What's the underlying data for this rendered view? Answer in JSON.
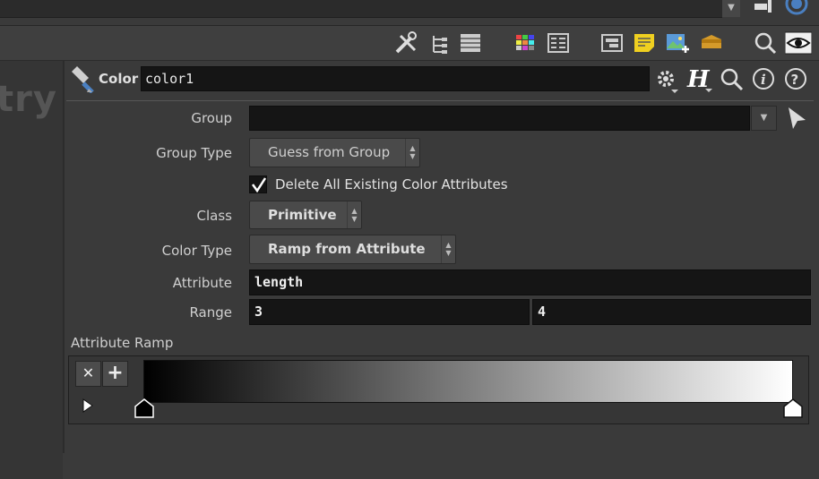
{
  "parameters": {
    "header": {
      "node_type_label": "Color",
      "node_name": "color1"
    },
    "group": {
      "label": "Group",
      "value": ""
    },
    "group_type": {
      "label": "Group Type",
      "value": "Guess from Group"
    },
    "delete_attrs": {
      "label": "Delete All Existing Color Attributes",
      "checked": true
    },
    "class": {
      "label": "Class",
      "value": "Primitive"
    },
    "color_type": {
      "label": "Color Type",
      "value": "Ramp from Attribute"
    },
    "attribute": {
      "label": "Attribute",
      "value": "length"
    },
    "range": {
      "label": "Range",
      "min": "3",
      "max": "4"
    },
    "ramp": {
      "label": "Attribute Ramp",
      "start_color": "#000000",
      "end_color": "#ffffff"
    }
  },
  "left_pane": {
    "partial_text": "try"
  },
  "colors": {
    "accent_blue": "#4a7fc0",
    "field_bg": "#151515",
    "panel_bg": "#3a3a3a"
  }
}
